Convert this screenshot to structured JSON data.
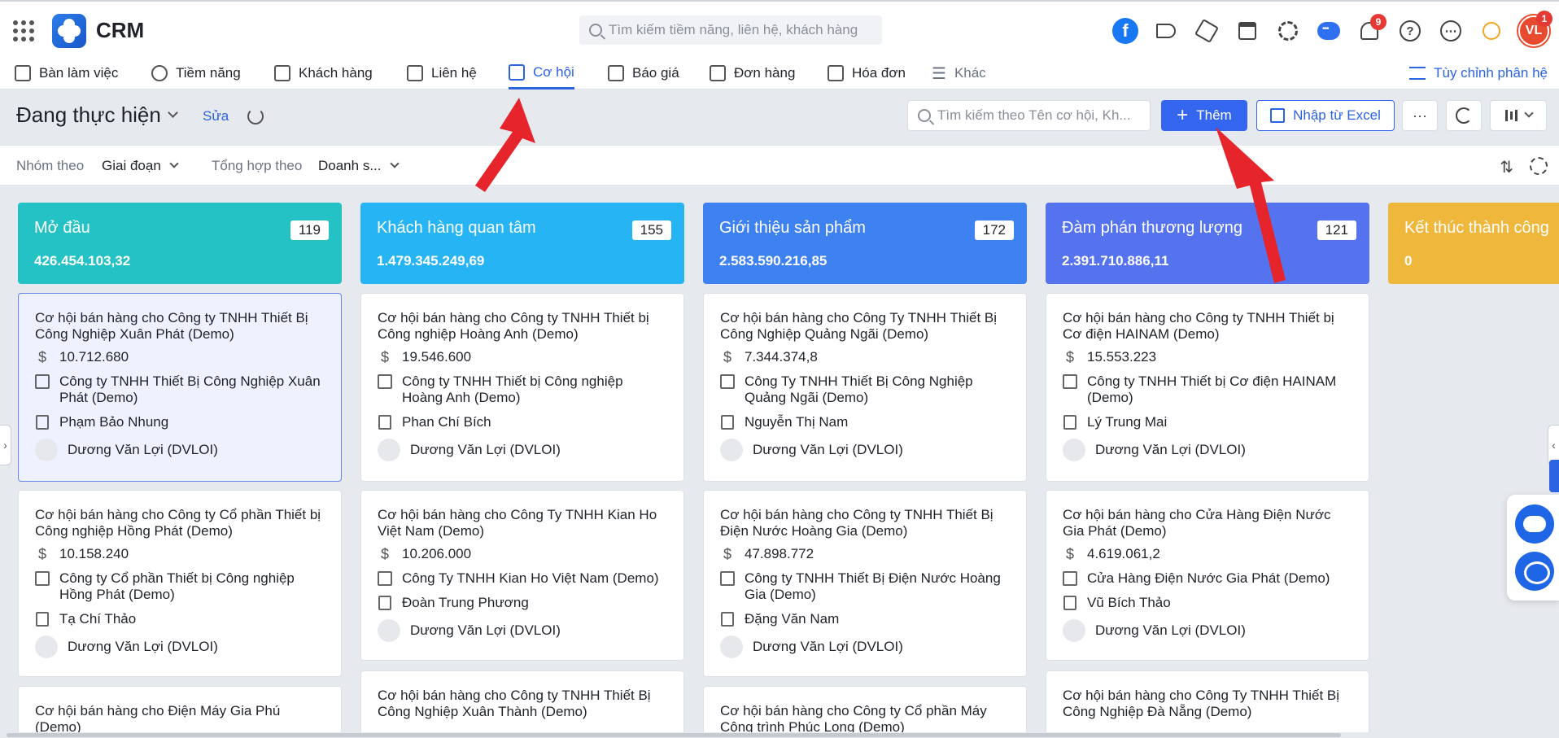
{
  "app": {
    "name": "CRM"
  },
  "top_search": {
    "placeholder": "Tìm kiếm tiềm năng, liên hệ, khách hàng"
  },
  "top_icons": {
    "notification_count": "9",
    "user_badge": "1",
    "user_initials": "VL"
  },
  "nav": {
    "items": [
      {
        "label": "Bàn làm việc"
      },
      {
        "label": "Tiềm năng"
      },
      {
        "label": "Khách hàng"
      },
      {
        "label": "Liên hệ"
      },
      {
        "label": "Cơ hội"
      },
      {
        "label": "Báo giá"
      },
      {
        "label": "Đơn hàng"
      },
      {
        "label": "Hóa đơn"
      },
      {
        "label": "Khác"
      }
    ],
    "active": "Cơ hội",
    "customize_label": "Tùy chỉnh phân hệ"
  },
  "toolbar": {
    "view_title": "Đang thực hiện",
    "edit_label": "Sửa",
    "search_placeholder": "Tìm kiếm theo Tên cơ hội, Kh...",
    "add_label": "Thêm",
    "import_label": "Nhập từ Excel",
    "more_label": "···"
  },
  "groupbar": {
    "group_by_label": "Nhóm theo",
    "group_by_value": "Giai đoạn",
    "aggregate_label": "Tổng hợp theo",
    "aggregate_value": "Doanh s..."
  },
  "colors": {
    "stage1": "#24c2c5",
    "stage2": "#26b4f5",
    "stage3": "#3e82f2",
    "stage4": "#5673ef",
    "stage5": "#f0b73d",
    "accent": "#3466f0",
    "arrow": "#e5242b"
  },
  "columns": [
    {
      "title": "Mở đầu",
      "count": "119",
      "total": "426.454.103,32",
      "cards": [
        {
          "title": "Cơ hội bán hàng cho Công ty TNHH Thiết Bị Công Nghiệp Xuân Phát (Demo)",
          "amount": "10.712.680",
          "company": "Công ty TNHH Thiết Bị Công Nghiệp Xuân Phát (Demo)",
          "contact": "Phạm Bảo Nhung",
          "owner": "Dương Văn Lợi (DVLOI)"
        },
        {
          "title": "Cơ hội bán hàng cho Công ty Cổ phần Thiết bị Công nghiệp Hồng Phát (Demo)",
          "amount": "10.158.240",
          "company": "Công ty Cổ phần Thiết bị Công nghiệp Hồng Phát (Demo)",
          "contact": "Tạ Chí Thảo",
          "owner": "Dương Văn Lợi (DVLOI)"
        },
        {
          "title": "Cơ hội bán hàng cho Điện Máy Gia Phú (Demo)"
        }
      ]
    },
    {
      "title": "Khách hàng quan tâm",
      "count": "155",
      "total": "1.479.345.249,69",
      "cards": [
        {
          "title": "Cơ hội bán hàng cho Công ty TNHH Thiết bị Công nghiệp Hoàng Anh (Demo)",
          "amount": "19.546.600",
          "company": "Công ty TNHH Thiết bị Công nghiệp Hoàng Anh (Demo)",
          "contact": "Phan Chí Bích",
          "owner": "Dương Văn Lợi (DVLOI)"
        },
        {
          "title": "Cơ hội bán hàng cho Công Ty TNHH Kian Ho Việt Nam (Demo)",
          "amount": "10.206.000",
          "company": "Công Ty TNHH Kian Ho Việt Nam (Demo)",
          "contact": "Đoàn Trung Phương",
          "owner": "Dương Văn Lợi (DVLOI)"
        },
        {
          "title": "Cơ hội bán hàng cho Công ty TNHH Thiết Bị Công Nghiệp Xuân Thành (Demo)"
        }
      ]
    },
    {
      "title": "Giới thiệu sản phẩm",
      "count": "172",
      "total": "2.583.590.216,85",
      "cards": [
        {
          "title": "Cơ hội bán hàng cho Công Ty TNHH Thiết Bị Công Nghiệp Quảng Ngãi (Demo)",
          "amount": "7.344.374,8",
          "company": "Công Ty TNHH Thiết Bị Công Nghiệp Quảng Ngãi (Demo)",
          "contact": "Nguyễn Thị Nam",
          "owner": "Dương Văn Lợi (DVLOI)"
        },
        {
          "title": "Cơ hội bán hàng cho Công ty TNHH Thiết Bị Điện Nước Hoàng Gia (Demo)",
          "amount": "47.898.772",
          "company": "Công ty TNHH Thiết Bị Điện Nước Hoàng Gia (Demo)",
          "contact": "Đặng Văn Nam",
          "owner": "Dương Văn Lợi (DVLOI)"
        },
        {
          "title": "Cơ hội bán hàng cho Công ty Cổ phần Máy Công trình Phúc Long (Demo)"
        }
      ]
    },
    {
      "title": "Đàm phán thương lượng",
      "count": "121",
      "total": "2.391.710.886,11",
      "cards": [
        {
          "title": "Cơ hội bán hàng cho Công ty TNHH Thiết bị Cơ điện HAINAM (Demo)",
          "amount": "15.553.223",
          "company": "Công ty TNHH Thiết bị Cơ điện HAINAM (Demo)",
          "contact": "Lý Trung Mai",
          "owner": "Dương Văn Lợi (DVLOI)"
        },
        {
          "title": "Cơ hội bán hàng cho Cửa Hàng Điện Nước Gia Phát (Demo)",
          "amount": "4.619.061,2",
          "company": "Cửa Hàng Điện Nước Gia Phát (Demo)",
          "contact": "Vũ Bích Thảo",
          "owner": "Dương Văn Lợi (DVLOI)"
        },
        {
          "title": "Cơ hội bán hàng cho Công Ty TNHH Thiết Bị Công Nghiệp Đà Nẵng (Demo)"
        }
      ]
    },
    {
      "title": "Kết thúc thành công",
      "count": "",
      "total": "0",
      "cards": []
    }
  ]
}
